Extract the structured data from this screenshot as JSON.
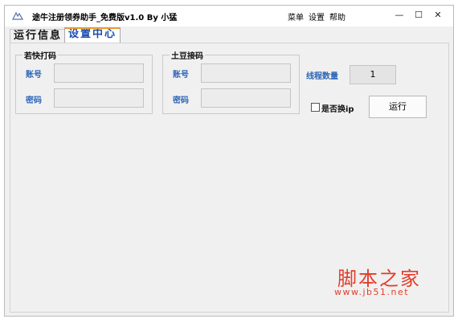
{
  "window": {
    "title": "途牛注册领券助手_免费版v1.0    By 小猛",
    "menu": [
      "菜单",
      "设置",
      "帮助"
    ],
    "controls": {
      "minimize": "—",
      "maximize": "☐",
      "close": "✕"
    }
  },
  "tabs": [
    {
      "label": "运行信息",
      "active": false
    },
    {
      "label": "设置中心",
      "active": true
    }
  ],
  "groups": {
    "ruokuai": {
      "title": "若快打码",
      "account_label": "账号",
      "account_value": "",
      "password_label": "密码",
      "password_value": ""
    },
    "tudou": {
      "title": "土豆接码",
      "account_label": "账号",
      "account_value": "",
      "password_label": "密码",
      "password_value": ""
    }
  },
  "threads": {
    "label": "线程数量",
    "value": "1"
  },
  "ip_switch": {
    "label": "是否换ip",
    "checked": false
  },
  "run_button": {
    "label": "运行"
  },
  "watermark": {
    "main": "脚本之家",
    "url": "www.jb51.net"
  },
  "colors": {
    "accent_label": "#2e66b8",
    "tab_accent": "#e89c2c",
    "watermark": "#e43c2a"
  }
}
